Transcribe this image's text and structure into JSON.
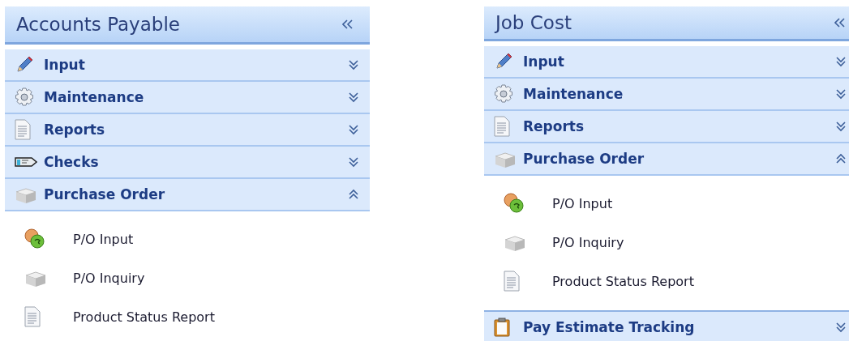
{
  "panels": [
    {
      "title": "Accounts Payable",
      "sections": [
        {
          "label": "Input",
          "kind": "input",
          "expanded": false
        },
        {
          "label": "Maintenance",
          "kind": "maintenance",
          "expanded": false
        },
        {
          "label": "Reports",
          "kind": "reports",
          "expanded": false
        },
        {
          "label": "Checks",
          "kind": "checks",
          "expanded": false
        },
        {
          "label": "Purchase Order",
          "kind": "purchase",
          "expanded": true,
          "items": [
            {
              "label": "P/O Input",
              "kind": "coins"
            },
            {
              "label": "P/O Inquiry",
              "kind": "brick"
            },
            {
              "label": "Product Status Report",
              "kind": "document"
            }
          ]
        }
      ]
    },
    {
      "title": "Job Cost",
      "sections": [
        {
          "label": "Input",
          "kind": "input",
          "expanded": false
        },
        {
          "label": "Maintenance",
          "kind": "maintenance",
          "expanded": false
        },
        {
          "label": "Reports",
          "kind": "reports",
          "expanded": false
        },
        {
          "label": "Purchase Order",
          "kind": "purchase",
          "expanded": true,
          "items": [
            {
              "label": "P/O Input",
              "kind": "coins"
            },
            {
              "label": "P/O Inquiry",
              "kind": "brick"
            },
            {
              "label": "Product Status Report",
              "kind": "document"
            }
          ]
        },
        {
          "label": "Pay Estimate Tracking",
          "kind": "tracking",
          "expanded": false
        }
      ]
    }
  ]
}
